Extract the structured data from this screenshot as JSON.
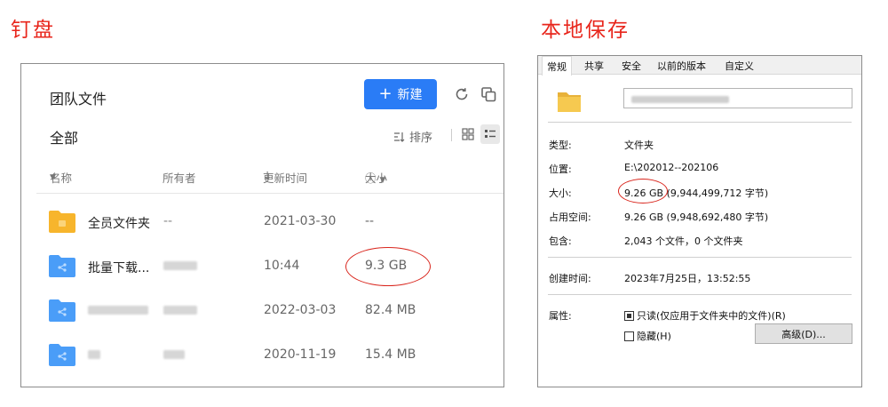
{
  "captions": {
    "left": "钉盘",
    "right": "本地保存"
  },
  "accent": "#e8261c",
  "drive": {
    "title": "团队文件",
    "new_button": "新建",
    "breadcrumb": "全部",
    "sort_label": "排序",
    "columns": {
      "name": "名称",
      "owner": "所有者",
      "time": "更新时间",
      "size": "大小"
    },
    "brand_color": "#2a7cf6",
    "rows": [
      {
        "name": "全员文件夹",
        "owner": "--",
        "time": "2021-03-30",
        "size": "--",
        "icon": "folder-yellow"
      },
      {
        "name": "批量下载...",
        "owner": "",
        "time": "10:44",
        "size": "9.3 GB",
        "icon": "folder-shared"
      },
      {
        "name": "",
        "owner": "",
        "time": "2022-03-03",
        "size": "82.4 MB",
        "icon": "folder-shared"
      },
      {
        "name": "",
        "owner": "",
        "time": "2020-11-19",
        "size": "15.4 MB",
        "icon": "folder-shared"
      }
    ]
  },
  "props": {
    "tabs": [
      "常规",
      "共享",
      "安全",
      "以前的版本",
      "自定义"
    ],
    "fields": {
      "type_label": "类型:",
      "type_value": "文件夹",
      "location_label": "位置:",
      "location_value": "E:\\202012--202106",
      "size_label": "大小:",
      "size_value_a": "9.26 GB",
      "size_value_b": "(9,944,499,712 字节)",
      "disk_label": "占用空间:",
      "disk_value": "9.26 GB (9,948,692,480 字节)",
      "contains_label": "包含:",
      "contains_value": "2,043 个文件，0 个文件夹",
      "created_label": "创建时间:",
      "created_value": "2023年7月25日，13:52:55",
      "attr_label": "属性:",
      "readonly_label": "只读(仅应用于文件夹中的文件)(R)",
      "hidden_label": "隐藏(H)",
      "advanced_button": "高级(D)..."
    }
  }
}
